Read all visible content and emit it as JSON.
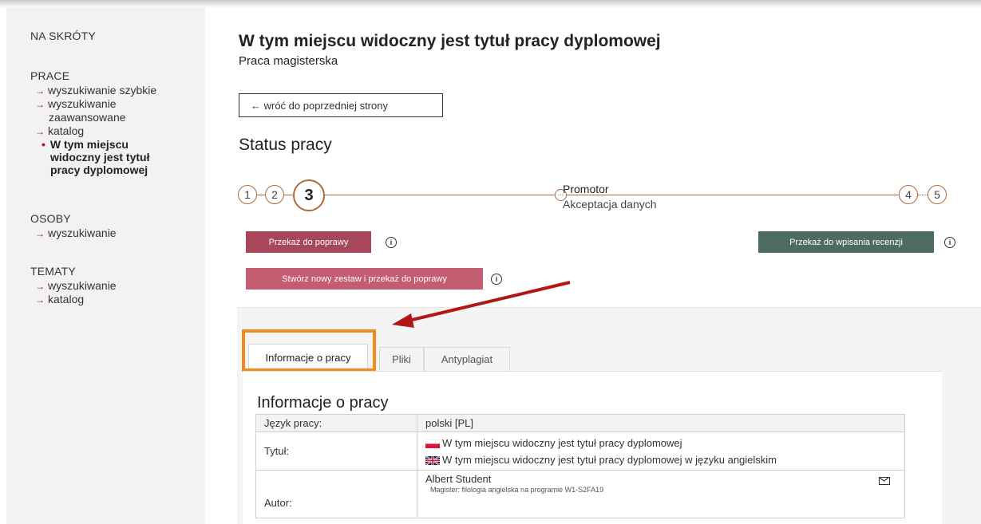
{
  "sidebar": {
    "na_skroty": "NA SKRÓTY",
    "prace": {
      "heading": "PRACE",
      "items": [
        "wyszukiwanie szybkie",
        "wyszukiwanie",
        "zaawansowane",
        "katalog"
      ],
      "current": [
        "W tym miejscu",
        "widoczny jest tytuł",
        "pracy dyplomowej"
      ]
    },
    "osoby": {
      "heading": "OSOBY",
      "items": [
        "wyszukiwanie"
      ]
    },
    "tematy": {
      "heading": "TEMATY",
      "items": [
        "wyszukiwanie",
        "katalog"
      ]
    }
  },
  "main": {
    "title": "W tym miejscu widoczny jest tytuł pracy dyplomowej",
    "subtitle": "Praca magisterska",
    "back_button": "← wróć do poprzedniej strony",
    "status_heading": "Status pracy",
    "stepper": {
      "steps": [
        "1",
        "2",
        "3",
        "4",
        "5"
      ],
      "current_role": "Promotor",
      "current_status": "Akceptacja danych",
      "progress_color": "#b06a3a"
    },
    "buttons": {
      "przekaz_do_poprawy": "Przekaż do poprawy",
      "stworz_zestaw": "Stwórz nowy zestaw i przekaż do poprawy",
      "przekaz_recenzji": "Przekaż do wpisania recenzji",
      "info_glyph": "i"
    },
    "tabs": [
      "Informacje o pracy",
      "Pliki",
      "Antyplagiat"
    ],
    "info_section": {
      "heading": "Informacje o pracy",
      "rows": {
        "jezyk_label": "Język pracy:",
        "jezyk_value": "polski [PL]",
        "tytul_label": "Tytuł:",
        "tytul_pl": "W tym miejscu widoczny jest tytuł pracy dyplomowej",
        "tytul_en": "W tym miejscu widoczny jest tytuł pracy dyplomowej w języku angielskim",
        "autor_label": "Autor:",
        "autor_name": "Albert Student",
        "autor_program": "Magister: filologia angielska na programie W1-S2FA19"
      }
    }
  },
  "colors": {
    "accent_red": "#b3151e",
    "btn_dark_red": "#a8475a",
    "btn_light_red": "#c45c72",
    "btn_green": "#4e6b62",
    "highlight_orange": "#f28a1e",
    "arrow_red": "#b01818"
  }
}
